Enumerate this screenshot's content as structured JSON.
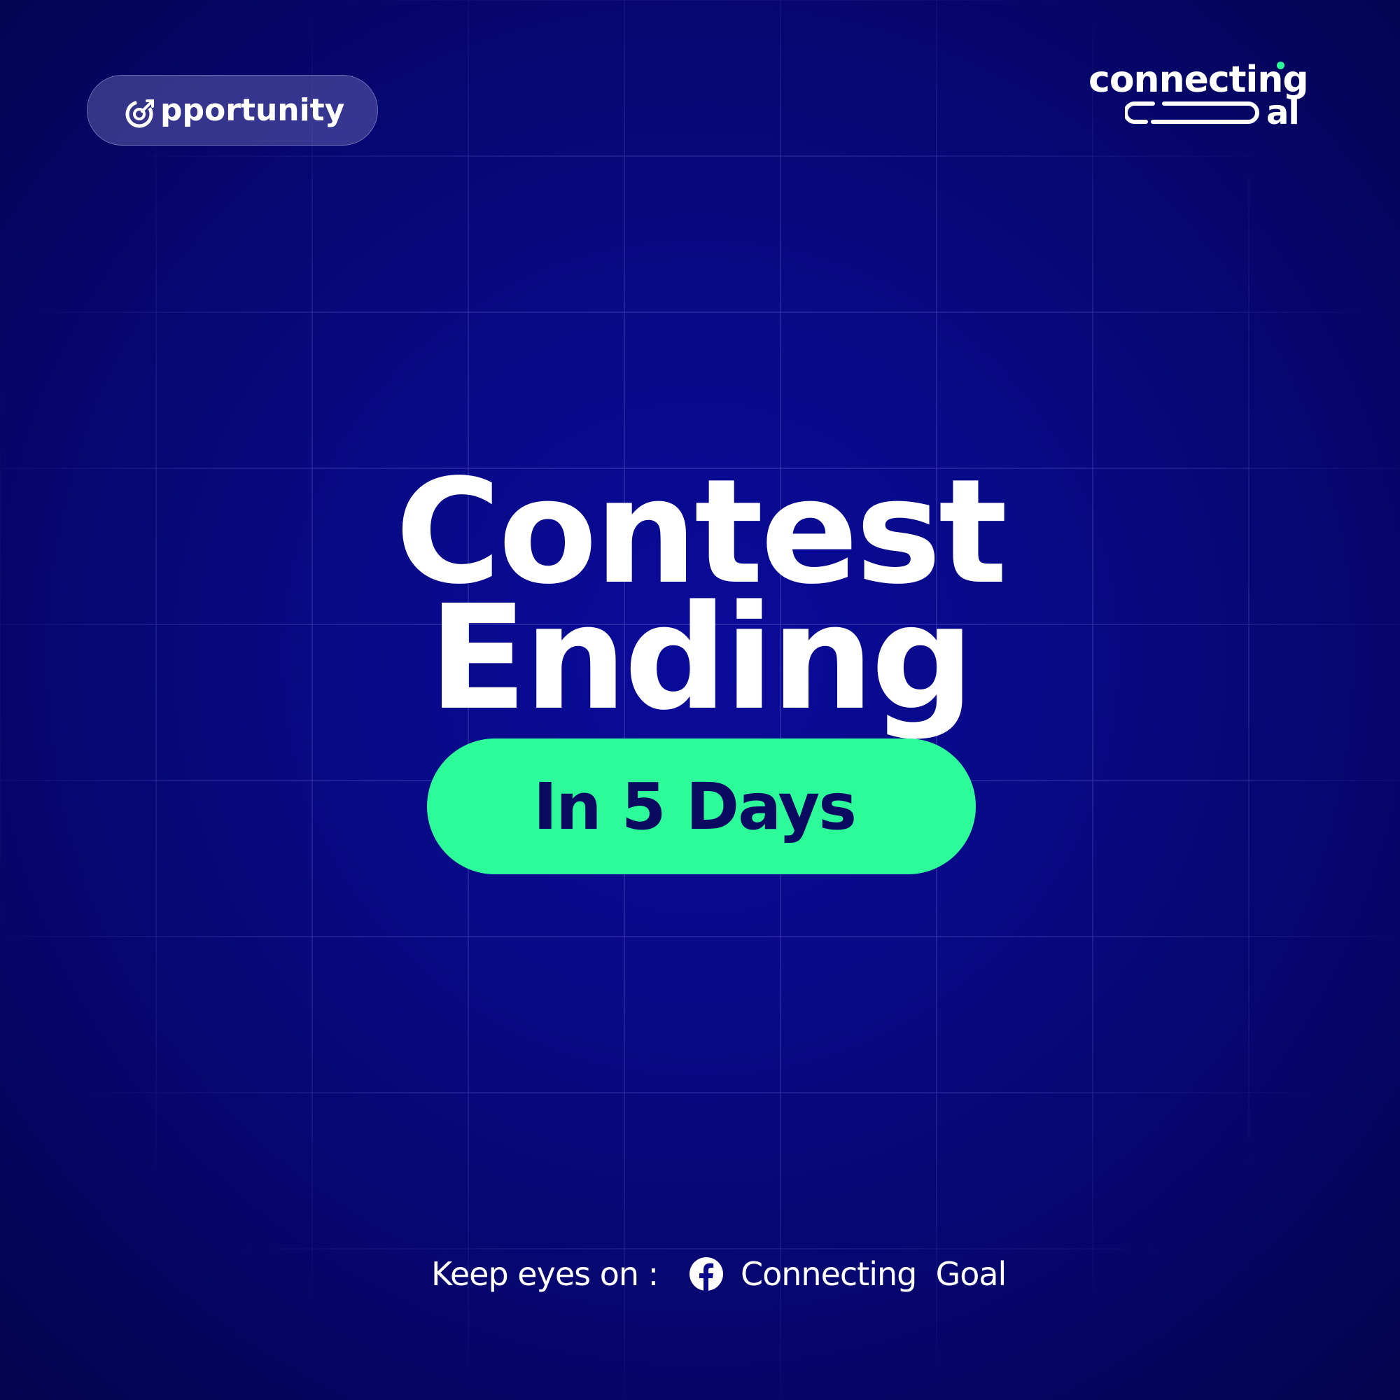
{
  "badge_brand": {
    "icon": "opportunity-logo-icon",
    "text": "pportunity"
  },
  "logo": {
    "line1": "connecting",
    "line2": "al",
    "accent_color": "#2dfb9a"
  },
  "headline": {
    "line1": "Contest",
    "line2": "Ending"
  },
  "countdown": {
    "text": "In 5 Days",
    "background_color": "#2dfb9a",
    "text_color": "#0a0a60"
  },
  "footer": {
    "label": "Keep eyes on :",
    "icon": "facebook-icon",
    "name": "Connecting  Goal"
  },
  "colors": {
    "background": "#08098a",
    "grid_line": "#4a4ab8"
  }
}
